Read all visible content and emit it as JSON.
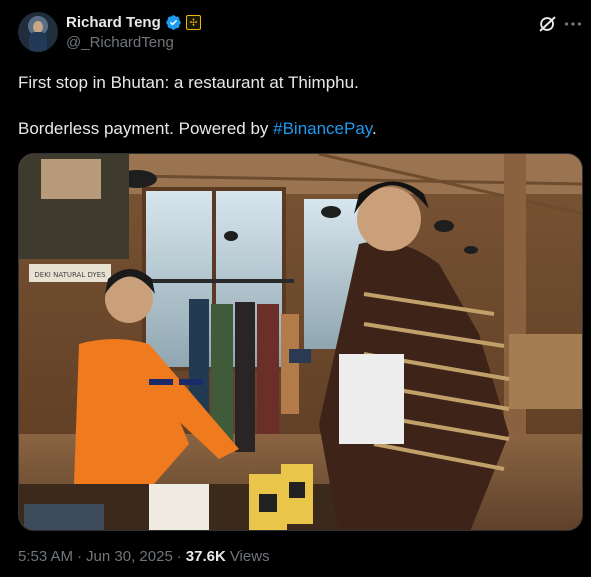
{
  "author": {
    "display_name": "Richard Teng",
    "handle": "@_RichardTeng",
    "verified": true,
    "affiliation": "Binance"
  },
  "post": {
    "line1": "First stop in Bhutan: a restaurant at Thimphu.",
    "line2_prefix": "Borderless payment. Powered by ",
    "hashtag": "#BinancePay",
    "line2_suffix": "."
  },
  "media": {
    "sign_text": "DEKI NATURAL DYES"
  },
  "meta": {
    "time": "5:53 AM",
    "sep1": "·",
    "date": "Jun 30, 2025",
    "sep2": "·",
    "views_count": "37.6K",
    "views_label": "Views"
  },
  "icons": [
    "verified-badge-icon",
    "binance-affiliate-icon",
    "grok-icon",
    "more-icon"
  ],
  "colors": {
    "link": "#1d9bf0",
    "verified": "#1d9bf0",
    "binance": "#f0b90b",
    "muted": "#71767b"
  }
}
